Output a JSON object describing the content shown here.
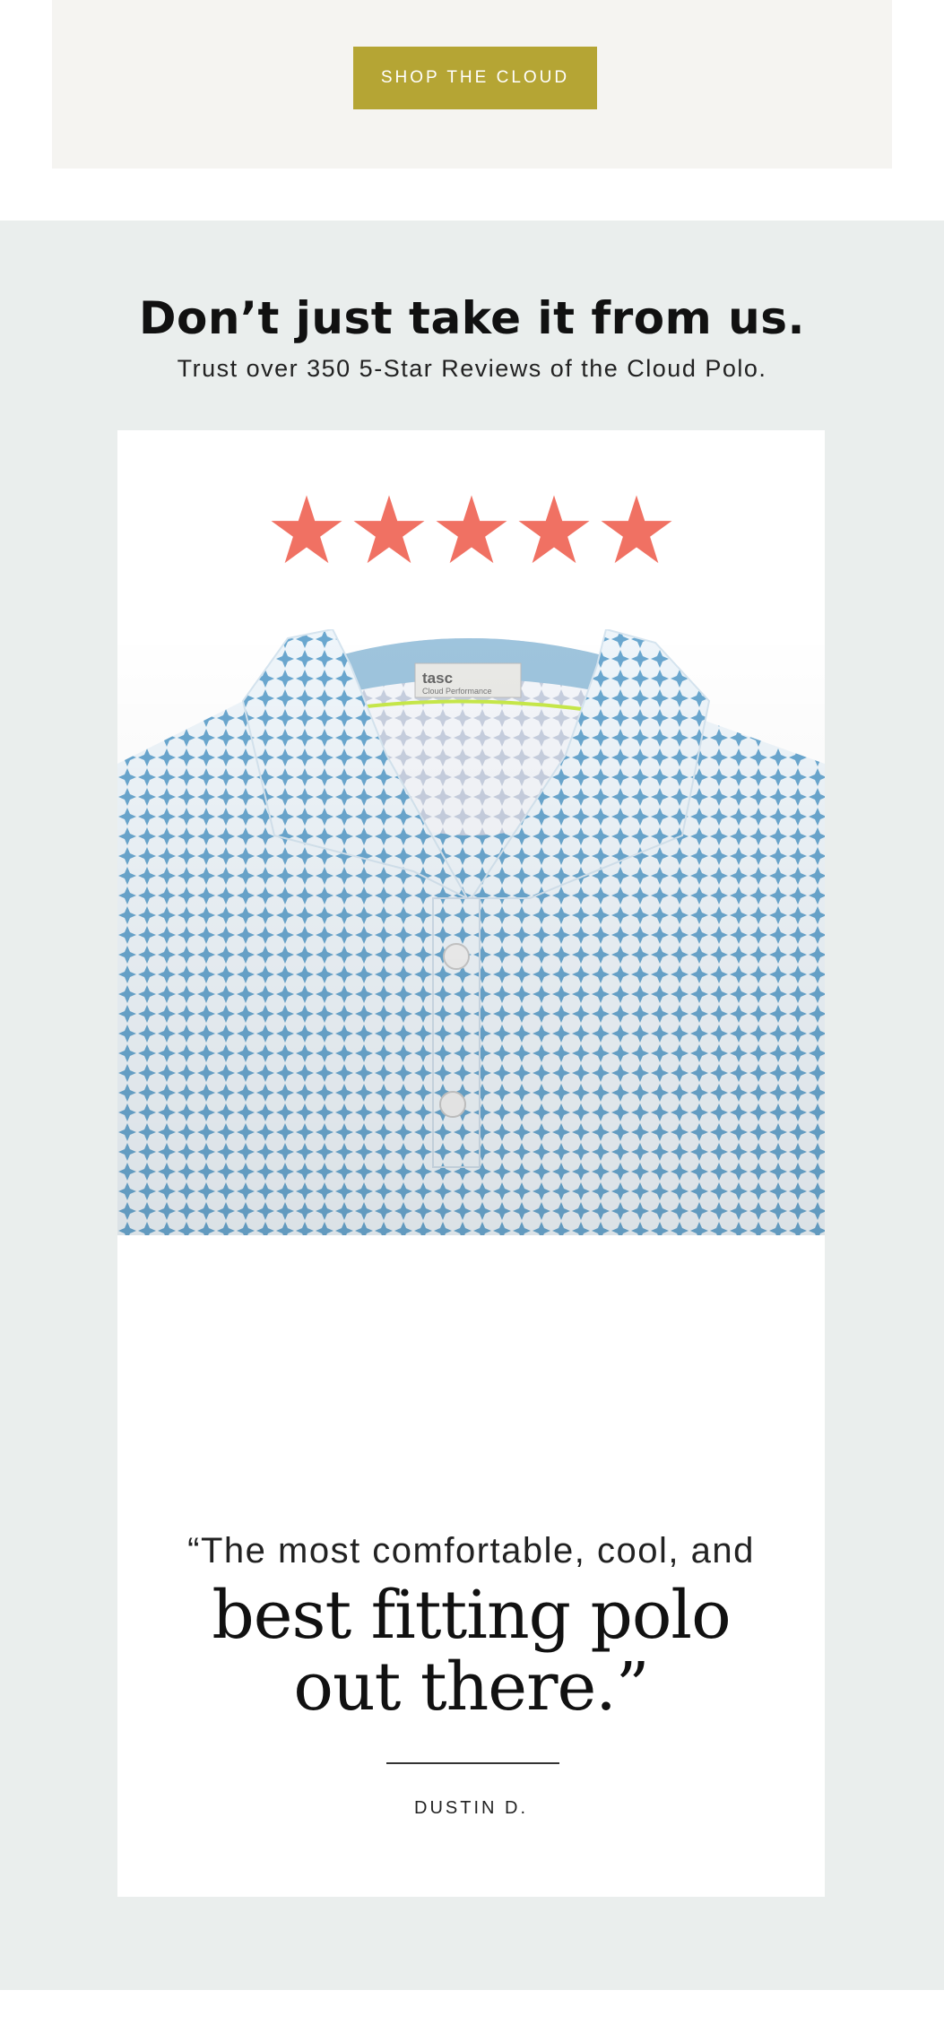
{
  "promo": {
    "button_label": "SHOP THE CLOUD",
    "button_color": "#b5a534"
  },
  "reviews": {
    "headline": "Don’t just take it from us.",
    "subhead": "Trust over 350 5-Star Reviews of the Cloud Polo.",
    "rating": 5,
    "rating_max": 5,
    "star_color": "#f07163",
    "product_image": {
      "icon": "polo-shirt-image",
      "label_brand": "tasc",
      "label_line": "Cloud Performance",
      "pattern_color": "#6aa7cf"
    },
    "quote_intro": "“The most comfortable, cool, and",
    "quote_emphasis_line1": "best fitting polo",
    "quote_emphasis_line2": "out there.”",
    "author": "DUSTIN D."
  },
  "colors": {
    "section_background": "#eaeeed",
    "top_background": "#f5f4f1"
  }
}
